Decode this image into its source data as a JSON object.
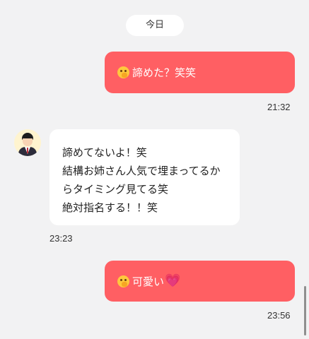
{
  "chat": {
    "date_label": "今日",
    "messages": [
      {
        "direction": "outgoing",
        "emoji": "smiling-face-with-hand-over-mouth",
        "text": "諦めた？笑笑",
        "time": "21:32"
      },
      {
        "direction": "incoming",
        "avatar": "suit-man-avatar",
        "lines": [
          "諦めてないよ！笑",
          "結構お姉さん人気で埋まってるか",
          "らタイミング見てる笑",
          "絶対指名する！！笑"
        ],
        "time": "23:23"
      },
      {
        "direction": "outgoing",
        "emoji": "smiling-face-with-hand-over-mouth",
        "text": "可愛い",
        "trailing_emoji": "💗",
        "time": "23:56"
      }
    ]
  },
  "colors": {
    "background": "#f2f2f3",
    "outgoing_bubble": "#ff5f63",
    "incoming_bubble": "#ffffff",
    "text_dark": "#222222"
  }
}
